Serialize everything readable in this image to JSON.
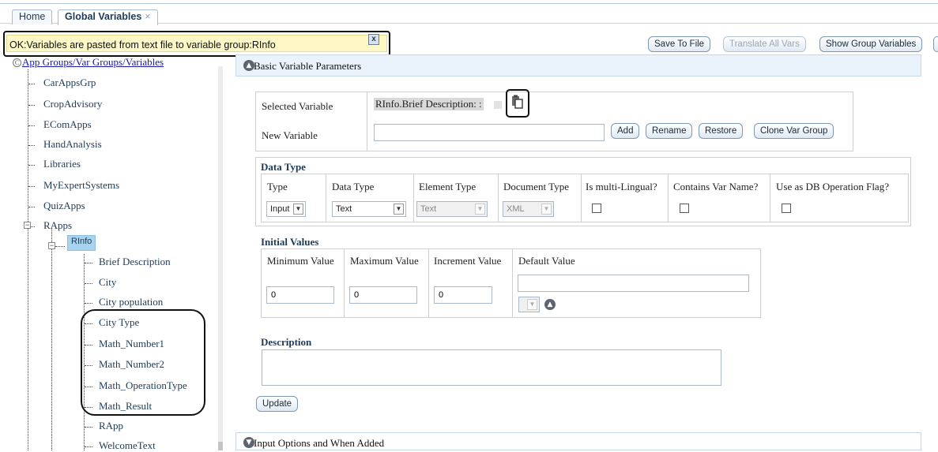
{
  "tabs": [
    {
      "label": "Home"
    },
    {
      "label": "Global Variables",
      "close": "×"
    }
  ],
  "notification": {
    "message": "OK:Variables are pasted from text file to variable group:RInfo",
    "close": "x"
  },
  "toolbar": {
    "save_to_file": "Save To File",
    "translate_all": "Translate All Vars",
    "show_group_vars": "Show Group Variables"
  },
  "tree": {
    "root": "App Groups/Var Groups/Variables",
    "groups": [
      "CarAppsGrp",
      "CropAdvisory",
      "EComApps",
      "HandAnalysis",
      "Libraries",
      "MyExpertSystems",
      "QuizApps",
      "RApps"
    ],
    "subgroup": "RInfo",
    "variables": [
      "Brief Description",
      "City",
      "City population",
      "City Type",
      "Math_Number1",
      "Math_Number2",
      "Math_OperationType",
      "Math_Result"
    ],
    "after": [
      "RApp",
      "WelcomeText"
    ]
  },
  "basic": {
    "title": "Basic Variable Parameters",
    "selected_label": "Selected Variable",
    "selected_value": "RInfo.Brief Description: :",
    "new_label": "New Variable",
    "new_value": "",
    "buttons": {
      "add": "Add",
      "rename": "Rename",
      "restore": "Restore",
      "clone": "Clone Var Group"
    }
  },
  "datatype": {
    "heading": "Data Type",
    "headers": [
      "Type",
      "Data Type",
      "Element Type",
      "Document Type",
      "Is multi-Lingual?",
      "Contains Var Name?",
      "Use as DB Operation Flag?"
    ],
    "type_value": "Input",
    "datatype_value": "Text",
    "element_value": "Text",
    "document_value": "XML"
  },
  "initial": {
    "heading": "Initial Values",
    "headers": [
      "Minimum Value",
      "Maximum Value",
      "Increment Value",
      "Default Value"
    ],
    "min": "0",
    "max": "0",
    "inc": "0",
    "default": ""
  },
  "description": {
    "heading": "Description",
    "value": ""
  },
  "update_label": "Update",
  "input_options": {
    "title": "Input Options and When Added"
  }
}
